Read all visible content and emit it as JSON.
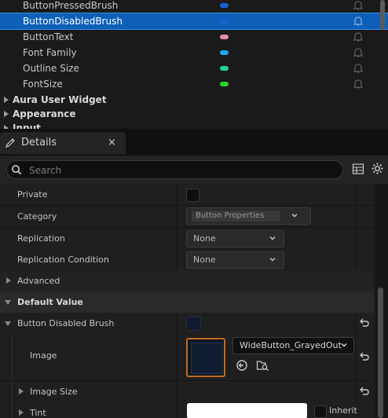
{
  "variables": {
    "items": [
      {
        "label": "ButtonPressedBrush",
        "color": "#1c5fd0"
      },
      {
        "label": "ButtonDisabledBrush",
        "color": "#1c5fd0",
        "selected": true
      },
      {
        "label": "ButtonText",
        "color": "#e88aa8"
      },
      {
        "label": "Font Family",
        "color": "#1fa4e8"
      },
      {
        "label": "Outline Size",
        "color": "#1fd3a0"
      },
      {
        "label": "FontSize",
        "color": "#2ad12a"
      }
    ],
    "categories": [
      "Aura User Widget",
      "Appearance",
      "Input"
    ]
  },
  "details": {
    "tab_label": "Details",
    "close_glyph": "×",
    "search_placeholder": "Search"
  },
  "properties": {
    "private_label": "Private",
    "private_checked": false,
    "category_label": "Category",
    "category_value": "Button Properties",
    "replication_label": "Replication",
    "replication_value": "None",
    "replication_condition_label": "Replication Condition",
    "replication_condition_value": "None",
    "advanced_label": "Advanced",
    "default_value_label": "Default Value",
    "button_disabled_brush_label": "Button Disabled Brush",
    "image_label": "Image",
    "image_asset": "WideButton_GrayedOut",
    "image_size_label": "Image Size",
    "tint_label": "Tint",
    "tint_color": "#ffffff",
    "tint_inherit_label": "Inherit"
  },
  "colors": {
    "selection": "#0e5fb8",
    "accent_orange": "#c46a22"
  }
}
